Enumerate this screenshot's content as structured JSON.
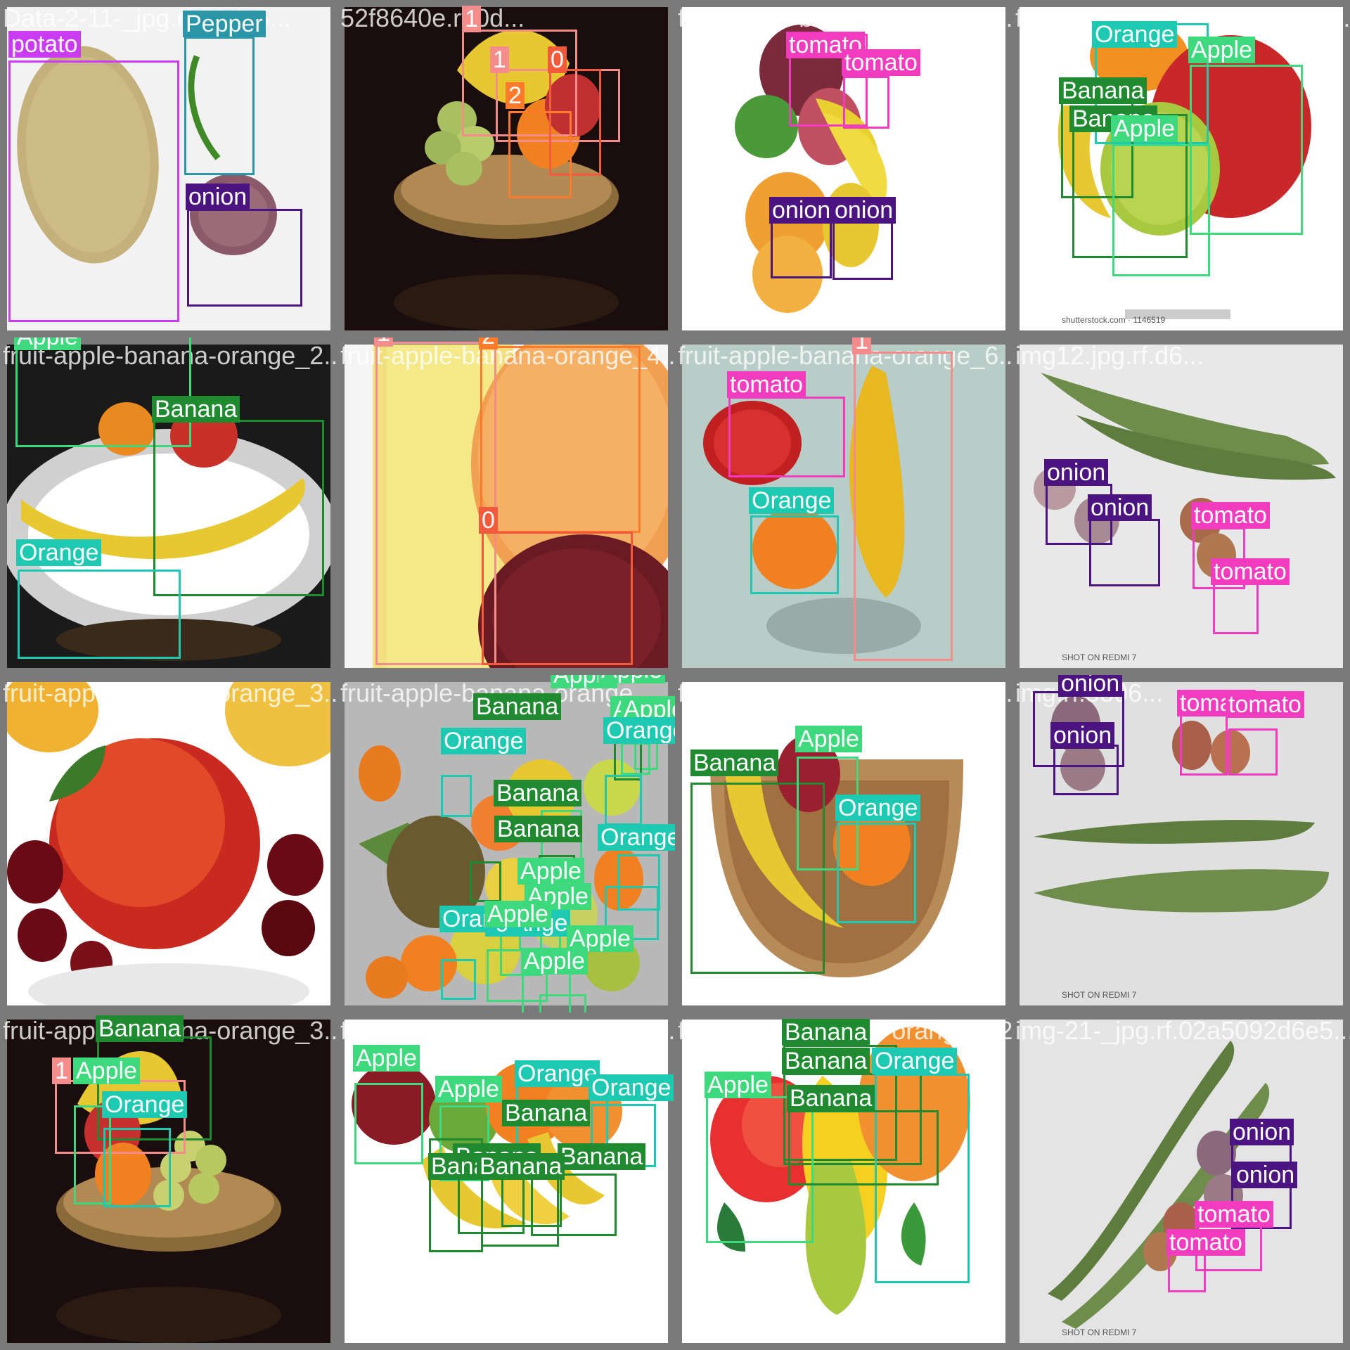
{
  "colors": {
    "potato": "#c93cf0",
    "Pepper": "#2b96a8",
    "onion": "#4b1480",
    "tomato": "#f23cbf",
    "Apple": "#3ed97d",
    "Banana": "#1f8a2f",
    "Orange": "#1ec9b1",
    "0": "#f25a3c",
    "1": "#f58c8c",
    "2": "#ff7a2a"
  },
  "tiles": [
    {
      "filename": "Data-2-11-_jpg.rf.81de5...",
      "scene": "potato-pepper-onion",
      "boxes": [
        {
          "label": "potato"
        },
        {
          "label": "Pepper"
        },
        {
          "label": "onion"
        }
      ]
    },
    {
      "filename": "52f8640e.rf.0d...",
      "scene": "fruit-plate",
      "boxes": [
        {
          "label": "1"
        },
        {
          "label": "1"
        },
        {
          "label": "0"
        },
        {
          "label": "2"
        }
      ]
    },
    {
      "filename": "fruit-apple-banana-orange_3...",
      "scene": "fruit-hang",
      "boxes": [
        {
          "label": "tomato"
        },
        {
          "label": "tomato"
        },
        {
          "label": "onion"
        },
        {
          "label": "onion"
        }
      ]
    },
    {
      "filename": "fruit-apple-banana-orange_5...",
      "scene": "apples-banana",
      "boxes": [
        {
          "label": "Orange"
        },
        {
          "label": "Apple"
        },
        {
          "label": "Banana"
        },
        {
          "label": "Banana"
        },
        {
          "label": "Apple"
        }
      ],
      "watermark": "shutterstock.com · 1146519"
    },
    {
      "filename": "fruit-apple-banana-orange_2...",
      "scene": "plate-banana",
      "boxes": [
        {
          "label": "Apple"
        },
        {
          "label": "Banana"
        },
        {
          "label": "Orange"
        }
      ]
    },
    {
      "filename": "fruit-apple-banana-orange_4...",
      "scene": "closeup",
      "boxes": [
        {
          "label": "1"
        },
        {
          "label": "2"
        },
        {
          "label": "0"
        }
      ]
    },
    {
      "filename": "fruit-apple-banana-orange_6...",
      "scene": "pear-banana",
      "boxes": [
        {
          "label": "1"
        },
        {
          "label": "tomato"
        },
        {
          "label": "Orange"
        }
      ]
    },
    {
      "filename": "img12.jpg.rf.d6...",
      "scene": "gourds-onions",
      "boxes": [
        {
          "label": "onion"
        },
        {
          "label": "onion"
        },
        {
          "label": "tomato"
        },
        {
          "label": "tomato"
        }
      ],
      "watermark": "SHOT ON REDMI 7"
    },
    {
      "filename": "fruit-apple-banana-orange_3...",
      "scene": "apple-cherries",
      "boxes": []
    },
    {
      "filename": "fruit-apple-banana-orange_...",
      "scene": "fruit-pile",
      "boxes": [
        {
          "label": "Apple"
        },
        {
          "label": "Apple"
        },
        {
          "label": "Banana"
        },
        {
          "label": "Apple"
        },
        {
          "label": "Apple"
        },
        {
          "label": "Orange"
        },
        {
          "label": "Orange"
        },
        {
          "label": "Orange"
        },
        {
          "label": "Apple"
        },
        {
          "label": "Banana"
        },
        {
          "label": "Banana"
        },
        {
          "label": "Orange"
        },
        {
          "label": "Apple"
        },
        {
          "label": "Orange"
        },
        {
          "label": "Apple"
        },
        {
          "label": "Apple"
        },
        {
          "label": "Apple"
        }
      ]
    },
    {
      "filename": "fruit-apple-banana-orange_6...",
      "scene": "bowl",
      "boxes": [
        {
          "label": "Banana"
        },
        {
          "label": "Apple"
        },
        {
          "label": "Orange"
        }
      ]
    },
    {
      "filename": "img.rf.5306...",
      "scene": "gourds-top",
      "boxes": [
        {
          "label": "onion"
        },
        {
          "label": "onion"
        },
        {
          "label": "tomato"
        },
        {
          "label": "tomato"
        }
      ],
      "watermark": "SHOT ON REDMI 7"
    },
    {
      "filename": "fruit-apple-banana-orange_3...",
      "scene": "fruit-plate-2",
      "boxes": [
        {
          "label": "Banana"
        },
        {
          "label": "1"
        },
        {
          "label": "Apple"
        },
        {
          "label": "Orange"
        }
      ]
    },
    {
      "filename": "fruit-apple-banana-orange_5...",
      "scene": "fruit-row",
      "boxes": [
        {
          "label": "Apple"
        },
        {
          "label": "Apple"
        },
        {
          "label": "Orange"
        },
        {
          "label": "Orange"
        },
        {
          "label": "Banana"
        },
        {
          "label": "Banana"
        },
        {
          "label": "Banana"
        },
        {
          "label": "Banana"
        },
        {
          "label": "Banana"
        }
      ]
    },
    {
      "filename": "fruit-apple-banana-orange_22...",
      "scene": "cartoon",
      "boxes": [
        {
          "label": "Banana"
        },
        {
          "label": "Banana"
        },
        {
          "label": "Orange"
        },
        {
          "label": "Apple"
        },
        {
          "label": "Banana"
        }
      ]
    },
    {
      "filename": "img-21-_jpg.rf.02a5092d6e5...",
      "scene": "gourds-diag",
      "boxes": [
        {
          "label": "onion"
        },
        {
          "label": "onion"
        },
        {
          "label": "tomato"
        },
        {
          "label": "tomato"
        }
      ],
      "watermark": "SHOT ON REDMI 7"
    }
  ]
}
